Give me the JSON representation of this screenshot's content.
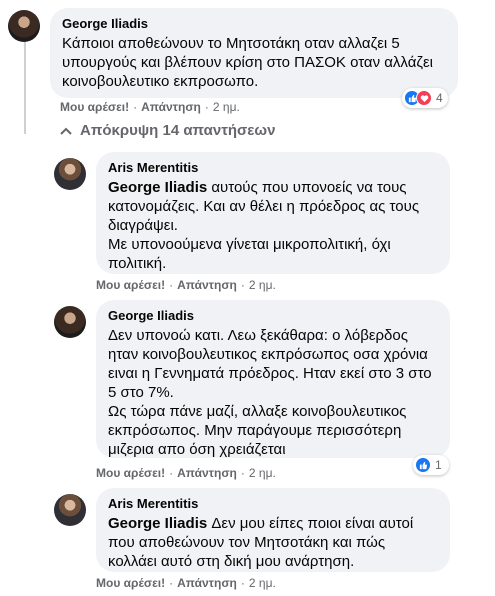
{
  "comments": [
    {
      "author": "George Iliadis",
      "text": "Κάποιοι αποθεώνουν το Μητσοτάκη οταν αλλαζει 5 υπουργούς και βλέπουν κρίση στο ΠΑΣΟΚ οταν αλλάζει κοινοβουλευτικο εκπροσωπο.",
      "like": "Μου αρέσει!",
      "reply": "Απάντηση",
      "time": "2 ημ.",
      "reaction_count": "4"
    }
  ],
  "hide_replies_label": "Απόκρυψη 14 απαντήσεων",
  "replies": [
    {
      "author": "Aris Merentitis",
      "mention": "George Iliadis",
      "text": " αυτούς που υπονοείς να τους κατονομάζεις. Και αν θέλει η πρόεδρος ας τους διαγράψει.\nΜε υπονοούμενα γίνεται μικροπολιτική, όχι πολιτική.",
      "like": "Μου αρέσει!",
      "reply": "Απάντηση",
      "time": "2 ημ."
    },
    {
      "author": "George Iliadis",
      "text": "Δεν υπονοώ κατι. Λεω ξεκάθαρα: ο λόβερδος ηταν κοινοβουλευτικος εκπρόσωπος οσα χρόνια ειναι η Γεννηματά πρόεδρος. Ηταν εκεί στο 3 στο 5 στο 7%.\nΩς τώρα πάνε μαζί, αλλαξε κοινοβουλευτικος εκπρόσωπος. Μην παράγουμε περισσότερη μιζερια απο όση χρειάζεται",
      "like": "Μου αρέσει!",
      "reply": "Απάντηση",
      "time": "2 ημ.",
      "reaction_count": "1"
    },
    {
      "author": "Aris Merentitis",
      "mention": "George Iliadis",
      "text": " Δεν μου είπες ποιοι είναι αυτοί που αποθεώνουν τον Μητσοτάκη και πώς κολλάει αυτό στη δική μου ανάρτηση.",
      "like": "Μου αρέσει!",
      "reply": "Απάντηση",
      "time": "2 ημ."
    }
  ],
  "colors": {
    "bubble": "#f0f2f5",
    "secondary": "#65676b",
    "like_blue": "#1877f2",
    "love_red": "#f33e58"
  }
}
